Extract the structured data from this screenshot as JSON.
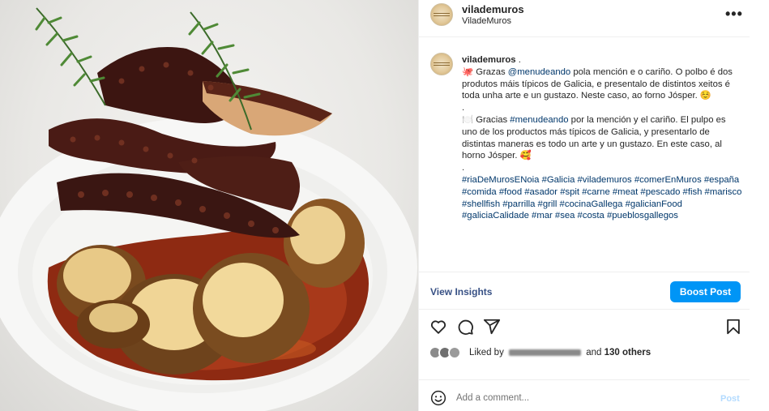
{
  "header": {
    "username": "vilademuros",
    "subtitle": "ViladeMuros",
    "more_icon": "more-horizontal-icon",
    "more_label": "•••"
  },
  "caption": {
    "username": "vilademuros",
    "separator": " .",
    "gl_emoji": "🐙",
    "gl_intro": " Grazas ",
    "gl_mention": "@menudeando",
    "gl_body": " pola mención e o cariño. O polbo é dos produtos máis típicos de Galicia, e presentalo de distintos xeitos é toda unha arte e un gustazo. Neste caso, ao forno Jósper. ",
    "gl_end_emoji": "☺️",
    "dot1": ".",
    "es_emoji": "🍽️",
    "es_intro": " Gracias ",
    "es_mention": "#menudeando",
    "es_body": " por la mención y el cariño. El pulpo es uno de los productos más típicos de Galicia, y presentarlo de distintas maneras es todo un arte y un gustazo. En este caso, al horno Jósper. ",
    "es_end_emoji": "🥰",
    "dot2": ".",
    "hashtags": "#riaDeMurosENoia #Galicia #vilademuros #comerEnMuros #españa #comida #food #asador #spit #carne #meat #pescado #fish #marisco #shellfish #parrilla #grill #cocinaGallega #galicianFood #galiciaCalidade #mar #sea #costa #pueblosgallegos"
  },
  "cta": {
    "view_insights": "View Insights",
    "boost_post": "Boost Post"
  },
  "actions": {
    "icons": [
      "heart-icon",
      "comment-icon",
      "share-icon",
      "bookmark-icon"
    ]
  },
  "likes": {
    "prefix": "Liked by",
    "middle": "and",
    "others": "130 others"
  },
  "comment": {
    "placeholder": "Add a comment...",
    "post_label": "Post",
    "emoji_icon": "emoji-icon"
  },
  "colors": {
    "link_blue": "#00376b",
    "button_blue": "#0095f6",
    "insights_blue": "#385185",
    "post_disabled": "#b3dbff",
    "divider": "#efefef"
  }
}
